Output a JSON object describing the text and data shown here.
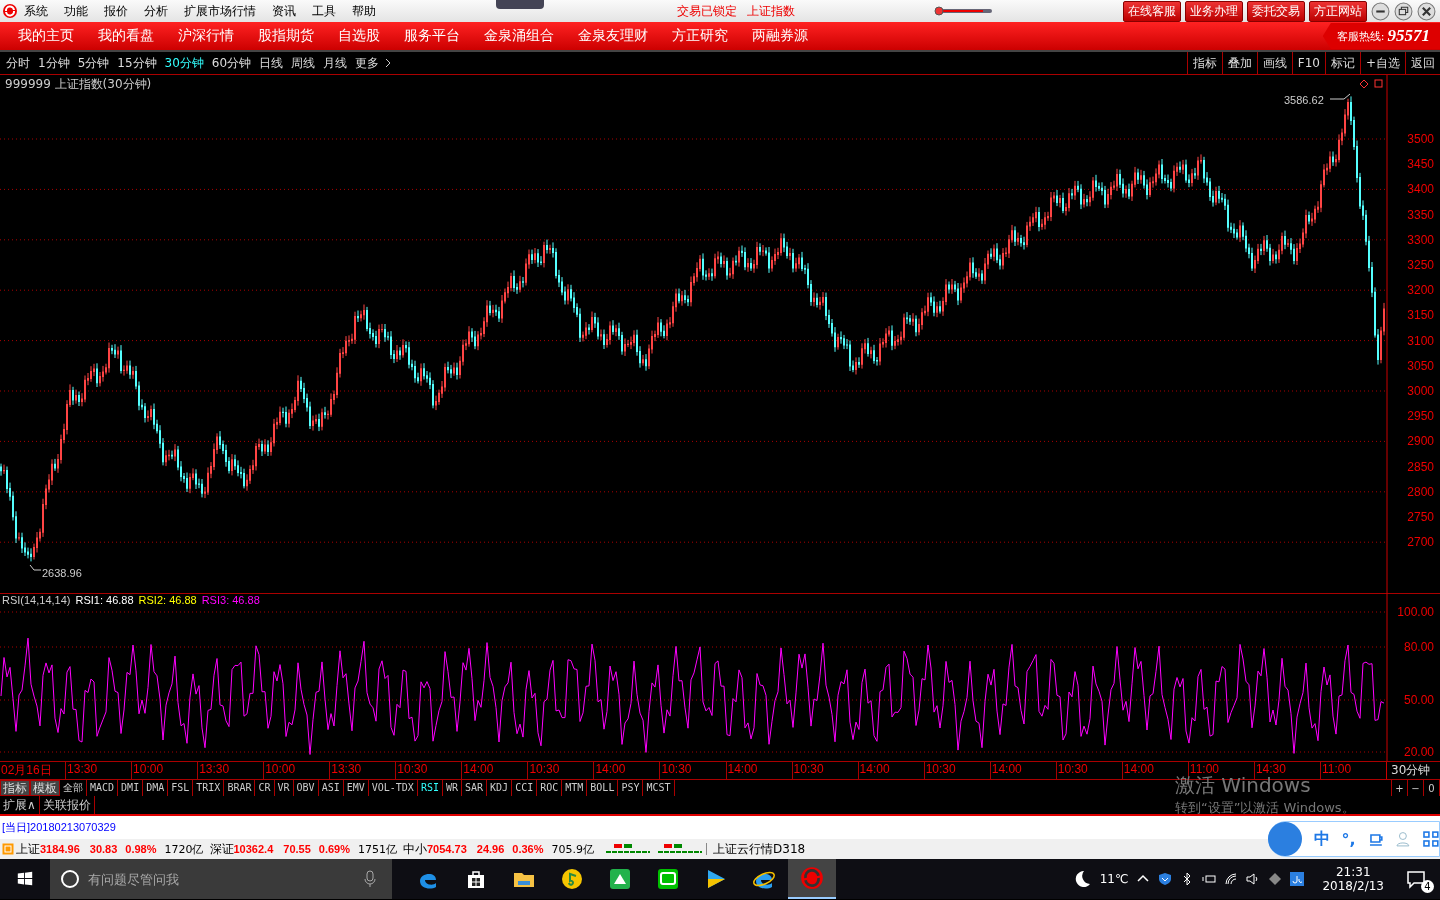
{
  "menu": [
    "系统",
    "功能",
    "报价",
    "分析",
    "扩展市场行情",
    "资讯",
    "工具",
    "帮助"
  ],
  "status_notes": [
    "交易已锁定",
    "上证指数"
  ],
  "top_buttons": [
    "在线客服",
    "业务办理",
    "委托交易",
    "方正网站"
  ],
  "nav": [
    "我的主页",
    "我的看盘",
    "沪深行情",
    "股指期货",
    "自选股",
    "服务平台",
    "金泉涌组合",
    "金泉友理财",
    "方正研究",
    "两融券源"
  ],
  "hotline": {
    "label": "客服热线:",
    "number": "95571"
  },
  "periods": [
    {
      "label": "分时",
      "selected": false
    },
    {
      "label": "1分钟",
      "selected": false
    },
    {
      "label": "5分钟",
      "selected": false
    },
    {
      "label": "15分钟",
      "selected": false
    },
    {
      "label": "30分钟",
      "selected": true
    },
    {
      "label": "60分钟",
      "selected": false
    },
    {
      "label": "日线",
      "selected": false
    },
    {
      "label": "周线",
      "selected": false
    },
    {
      "label": "月线",
      "selected": false
    },
    {
      "label": "更多",
      "selected": false
    }
  ],
  "chart_tools": [
    "指标",
    "叠加",
    "画线",
    "F10",
    "标记",
    "+自选",
    "返回"
  ],
  "chart": {
    "title": "999999 上证指数(30分钟)",
    "high": "3586.62",
    "low": "2638.96",
    "price_ticks": [
      "3500",
      "3450",
      "3400",
      "3350",
      "3300",
      "3250",
      "3200",
      "3150",
      "3100",
      "3050",
      "3000",
      "2950",
      "2900",
      "2850",
      "2800",
      "2750",
      "2700"
    ]
  },
  "rsi": {
    "label": "RSI(14,14,14)",
    "series": [
      {
        "text": "RSI1: 46.88",
        "color": "#ffffff"
      },
      {
        "text": "RSI2: 46.88",
        "color": "#ffff00"
      },
      {
        "text": "RSI3: 46.88",
        "color": "#ff00ff"
      }
    ],
    "ticks": [
      "100.00",
      "80.00",
      "50.00",
      "20.00"
    ]
  },
  "time_axis": [
    "02月16日",
    "13:30",
    "10:00",
    "13:30",
    "10:00",
    "13:30",
    "10:30",
    "14:00",
    "10:30",
    "14:00",
    "10:30",
    "14:00",
    "10:30",
    "14:00",
    "10:30",
    "14:00",
    "10:30",
    "14:00",
    "11:00",
    "14:30",
    "11:00"
  ],
  "period_label": "30分钟",
  "panel_buttons": [
    "指标",
    "模板"
  ],
  "indicators": [
    {
      "label": "全部",
      "selected": false
    },
    {
      "label": "MACD",
      "selected": false
    },
    {
      "label": "DMI",
      "selected": false
    },
    {
      "label": "DMA",
      "selected": false
    },
    {
      "label": "FSL",
      "selected": false
    },
    {
      "label": "TRIX",
      "selected": false
    },
    {
      "label": "BRAR",
      "selected": false
    },
    {
      "label": "CR",
      "selected": false
    },
    {
      "label": "VR",
      "selected": false
    },
    {
      "label": "OBV",
      "selected": false
    },
    {
      "label": "ASI",
      "selected": false
    },
    {
      "label": "EMV",
      "selected": false
    },
    {
      "label": "VOL-TDX",
      "selected": false
    },
    {
      "label": "RSI",
      "selected": true
    },
    {
      "label": "WR",
      "selected": false
    },
    {
      "label": "SAR",
      "selected": false
    },
    {
      "label": "KDJ",
      "selected": false
    },
    {
      "label": "CCI",
      "selected": false
    },
    {
      "label": "ROC",
      "selected": false
    },
    {
      "label": "MTM",
      "selected": false
    },
    {
      "label": "BOLL",
      "selected": false
    },
    {
      "label": "PSY",
      "selected": false
    },
    {
      "label": "MCST",
      "selected": false
    }
  ],
  "zoom_buttons": [
    "+",
    "−",
    "0"
  ],
  "extra_tabs": [
    "扩展∧",
    "关联报价"
  ],
  "activation": {
    "title": "激活 Windows",
    "subtitle": "转到“设置”以激活 Windows。"
  },
  "info_line": "[当日]20180213070329",
  "market": [
    {
      "name": "上证",
      "price": "3184.96",
      "change": "30.83",
      "pct": "0.98%",
      "volume": "1720亿"
    },
    {
      "name": "深证",
      "price": "10362.4",
      "change": "70.55",
      "pct": "0.69%",
      "volume": "1751亿"
    },
    {
      "name": "中小",
      "price": "7054.73",
      "change": "24.96",
      "pct": "0.36%",
      "volume": "705.9亿"
    }
  ],
  "cloud": "上证云行情D318",
  "ime": [
    "中",
    "°,"
  ],
  "taskbar": {
    "search_placeholder": "有问题尽管问我",
    "weather": "11℃",
    "time": "21:31",
    "date": "2018/2/13",
    "notifications": "4"
  }
}
